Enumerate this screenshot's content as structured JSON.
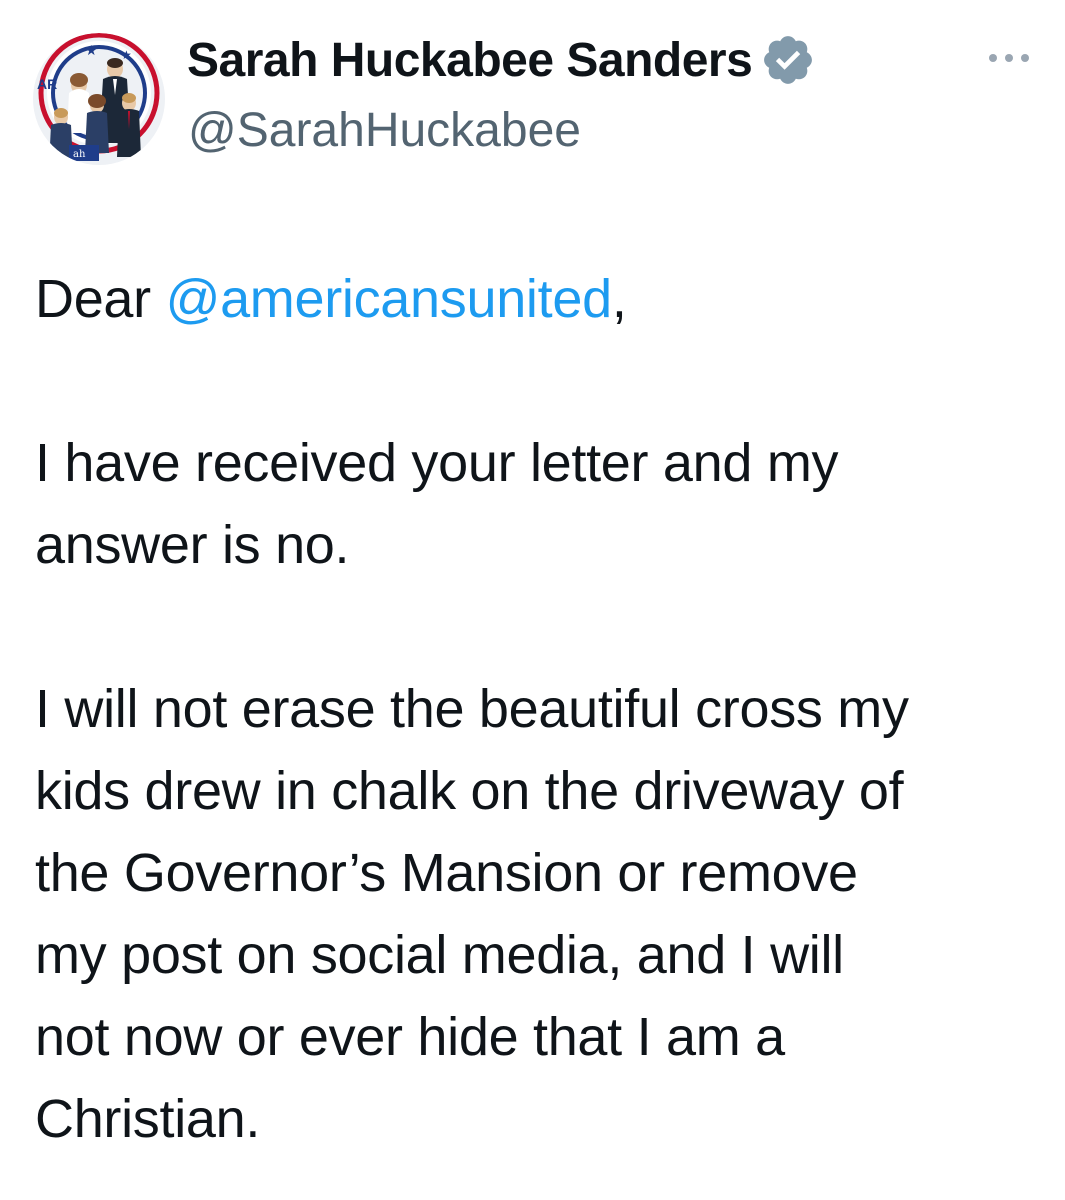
{
  "tweet": {
    "author": {
      "display_name": "Sarah Huckabee Sanders",
      "handle": "@SarahHuckabee",
      "verified_icon": "verified-badge-icon",
      "verified_color": "#829aab",
      "avatar_text": "AR"
    },
    "more_icon": "more-horizontal-icon",
    "body": {
      "salutation_prefix": "Dear ",
      "mention": "@americansunited",
      "salutation_suffix": ",",
      "paragraph_2_line_1": "I have received your letter and my",
      "paragraph_2_line_2": "answer is no.",
      "paragraph_3_line_1": "I will not erase the beautiful cross my",
      "paragraph_3_line_2": "kids drew in chalk on the driveway of",
      "paragraph_3_line_3": "the Governor’s Mansion or remove",
      "paragraph_3_line_4": "my post on social media, and I will",
      "paragraph_3_line_5": "not now or ever hide that I am a",
      "paragraph_3_line_6": "Christian."
    },
    "colors": {
      "text": "#0f1419",
      "secondary": "#536471",
      "link": "#1d9bf0"
    }
  }
}
